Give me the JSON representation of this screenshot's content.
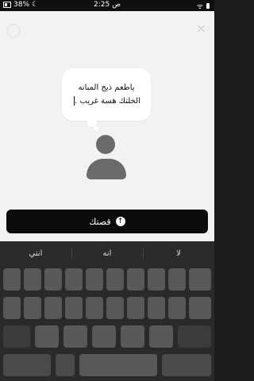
{
  "status_bar": {
    "battery": "38%",
    "time": "2:25",
    "ampm": "ص"
  },
  "bubble": {
    "line1": "ياطعم ذيج المبانه",
    "line2": "الخلتك هسة غريب ."
  },
  "send_button": {
    "label": "قصتك"
  },
  "keyboard": {
    "suggestions": [
      "انتي",
      "انه",
      "لا"
    ]
  },
  "icons": {
    "battery": "battery-icon",
    "dnd": "moon-icon",
    "wifi": "wifi-icon",
    "signal": "signal-icon",
    "close": "close-icon",
    "arrow_up": "arrow-up-icon"
  }
}
